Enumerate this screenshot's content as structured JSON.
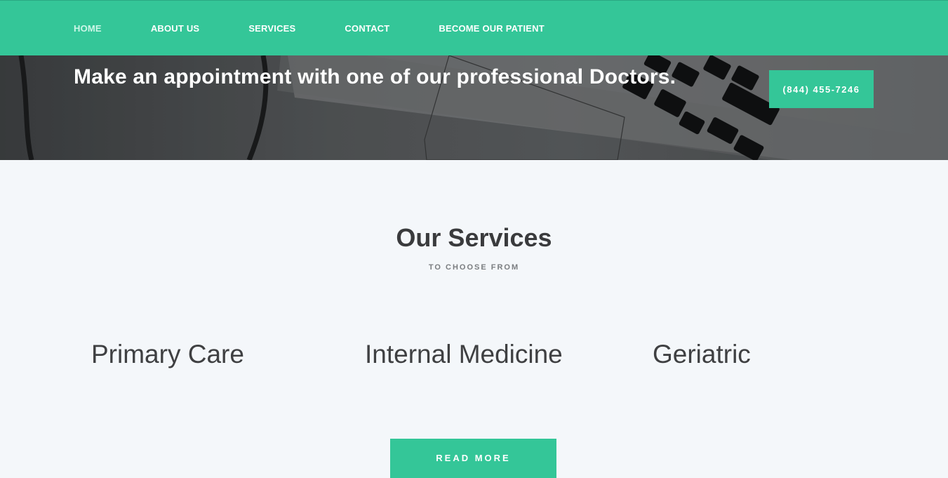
{
  "nav": {
    "items": [
      {
        "label": "HOME"
      },
      {
        "label": "ABOUT US"
      },
      {
        "label": "SERVICES"
      },
      {
        "label": "CONTACT"
      },
      {
        "label": "BECOME OUR PATIENT"
      }
    ]
  },
  "hero": {
    "title": "Make an appointment with one of our professional Doctors.",
    "phone": "(844) 455-7246"
  },
  "services": {
    "title": "Our Services",
    "subtitle": "TO CHOOSE FROM",
    "items": [
      {
        "label": "Primary Care"
      },
      {
        "label": "Internal Medicine"
      },
      {
        "label": "Geriatric"
      }
    ],
    "read_more": "READ MORE"
  },
  "colors": {
    "accent": "#34c698",
    "text_dark": "#3a3b3d",
    "background": "#f4f7fa"
  }
}
